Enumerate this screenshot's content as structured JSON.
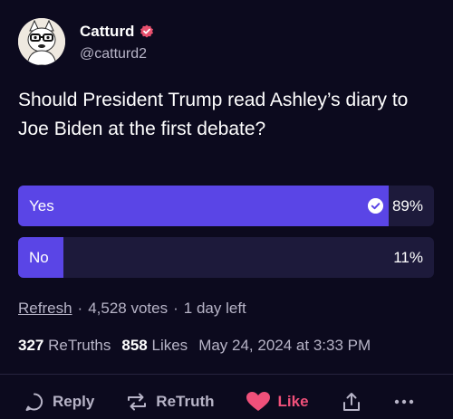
{
  "author": {
    "display_name": "Catturd",
    "handle": "@catturd2",
    "verified": true,
    "avatar_icon": "cat-with-glasses-avatar"
  },
  "post": {
    "text": "Should President Trump read Ashley’s diary to Joe Biden at the first debate?"
  },
  "poll": {
    "options": [
      {
        "label": "Yes",
        "percent_text": "89%",
        "percent": 89,
        "selected": true
      },
      {
        "label": "No",
        "percent_text": "11%",
        "percent": 11,
        "selected": false
      }
    ],
    "refresh_label": "Refresh",
    "votes_text": "4,528 votes",
    "time_left": "1 day left",
    "fill_color": "#5a45e6",
    "track_color": "#1d1a3b"
  },
  "stats": {
    "retruths_count": "327",
    "retruths_label": "ReTruths",
    "likes_count": "858",
    "likes_label": "Likes",
    "timestamp": "May 24, 2024 at 3:33 PM"
  },
  "actions": {
    "reply_label": "Reply",
    "retruth_label": "ReTruth",
    "like_label": "Like"
  },
  "colors": {
    "background": "#0c0a1e",
    "accent": "#5a45e6",
    "like": "#f0507a",
    "verified": "#e8506e"
  }
}
